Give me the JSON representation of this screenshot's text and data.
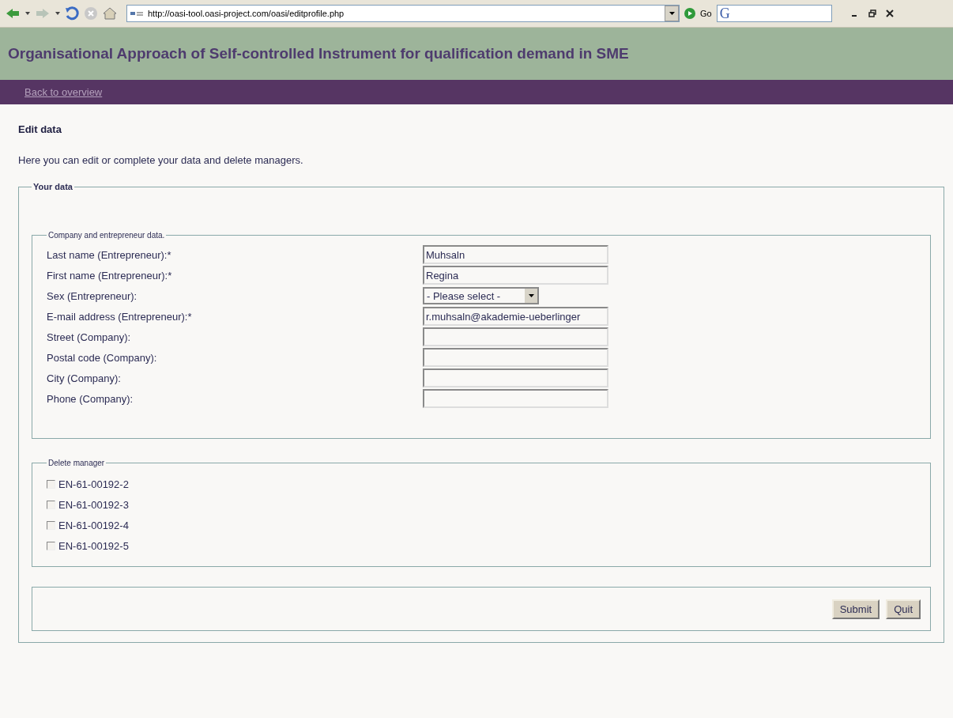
{
  "browser": {
    "address": "http://oasi-tool.oasi-project.com/oasi/editprofile.php",
    "go_label": "Go",
    "search_logo": "G"
  },
  "header": {
    "title": "Organisational Approach of Self-controlled Instrument for qualification demand in SME"
  },
  "nav": {
    "link": "Back to overview"
  },
  "page": {
    "heading": "Edit data",
    "intro": "Here you can edit or complete your data and delete managers."
  },
  "your_data": {
    "legend": "Your data",
    "company": {
      "legend": "Company and entrepreneur data.",
      "fields": [
        {
          "kind": "text",
          "label": "Last name (Entrepreneur):*",
          "value": "Muhsaln"
        },
        {
          "kind": "text",
          "label": "First name (Entrepreneur):*",
          "value": "Regina"
        },
        {
          "kind": "select",
          "label": "Sex (Entrepreneur):",
          "value": "- Please select -"
        },
        {
          "kind": "text",
          "label": "E-mail address (Entrepreneur):*",
          "value": "r.muhsaln@akademie-ueberlinger"
        },
        {
          "kind": "text",
          "label": "Street (Company):"
        },
        {
          "kind": "text",
          "label": "Postal code (Company):"
        },
        {
          "kind": "text",
          "label": "City (Company):"
        },
        {
          "kind": "text",
          "label": "Phone (Company):"
        }
      ]
    },
    "delete_manager": {
      "legend": "Delete manager",
      "managers": [
        {
          "label": "EN-61-00192-2",
          "checked": false
        },
        {
          "label": "EN-61-00192-3",
          "checked": false
        },
        {
          "label": "EN-61-00192-4",
          "checked": false
        },
        {
          "label": "EN-61-00192-5",
          "checked": false
        }
      ]
    },
    "buttons": [
      "Submit",
      "Quit"
    ]
  }
}
